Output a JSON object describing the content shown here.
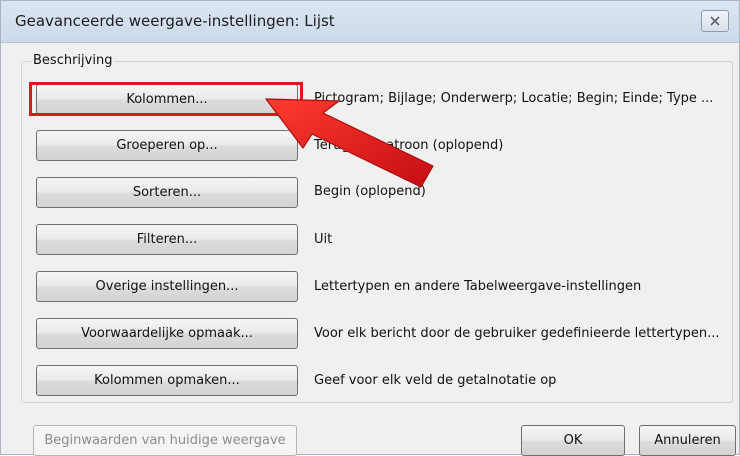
{
  "window": {
    "title": "Geavanceerde weergave-instellingen: Lijst",
    "close_icon": "close-icon"
  },
  "section": {
    "caption": "Beschrijving"
  },
  "rows": [
    {
      "label": "Kolommen...",
      "description": "Pictogram; Bijlage; Onderwerp; Locatie; Begin; Einde; Type ...",
      "highlighted": true
    },
    {
      "label": "Groeperen op...",
      "description": "Terugkeerpatroon (oplopend)"
    },
    {
      "label": "Sorteren...",
      "description": "Begin (oplopend)"
    },
    {
      "label": "Filteren...",
      "description": "Uit"
    },
    {
      "label": "Overige instellingen...",
      "description": "Lettertypen en andere Tabelweergave-instellingen"
    },
    {
      "label": "Voorwaardelijke opmaak...",
      "description": "Voor elk bericht door de gebruiker gedefinieerde lettertypen..."
    },
    {
      "label": "Kolommen opmaken...",
      "description": "Geef voor elk veld de getalnotatie op"
    }
  ],
  "footer": {
    "reset_label": "Beginwaarden van huidige weergave",
    "ok_label": "OK",
    "cancel_label": "Annuleren"
  },
  "colors": {
    "annotation": "#e5141b"
  }
}
